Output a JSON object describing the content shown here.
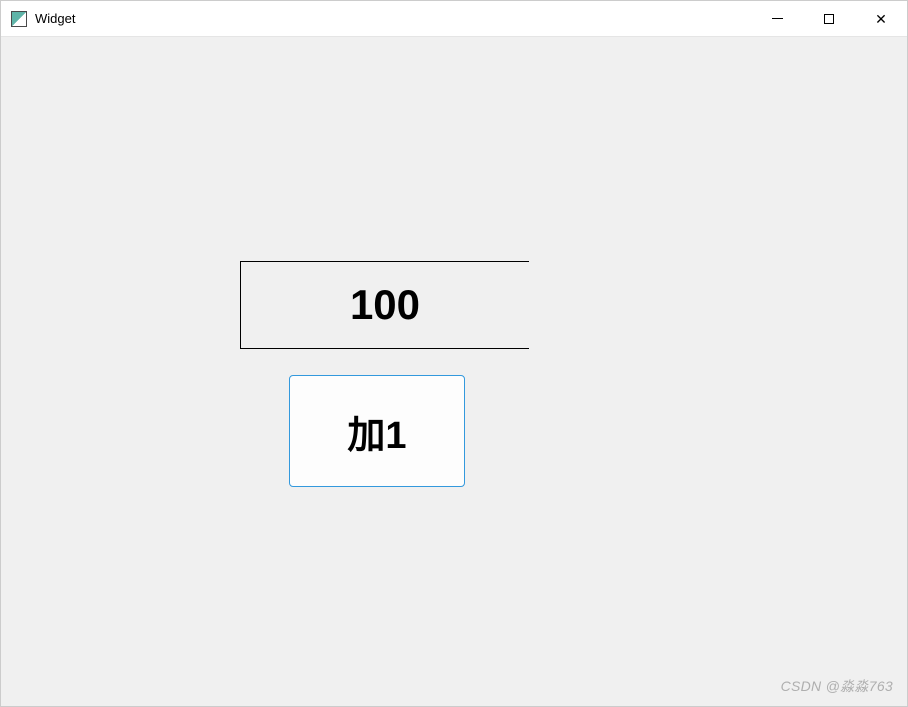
{
  "window": {
    "title": "Widget"
  },
  "counter": {
    "value": "100"
  },
  "button": {
    "increment_label": "加1"
  },
  "watermark": {
    "text": "CSDN @淼淼763"
  }
}
